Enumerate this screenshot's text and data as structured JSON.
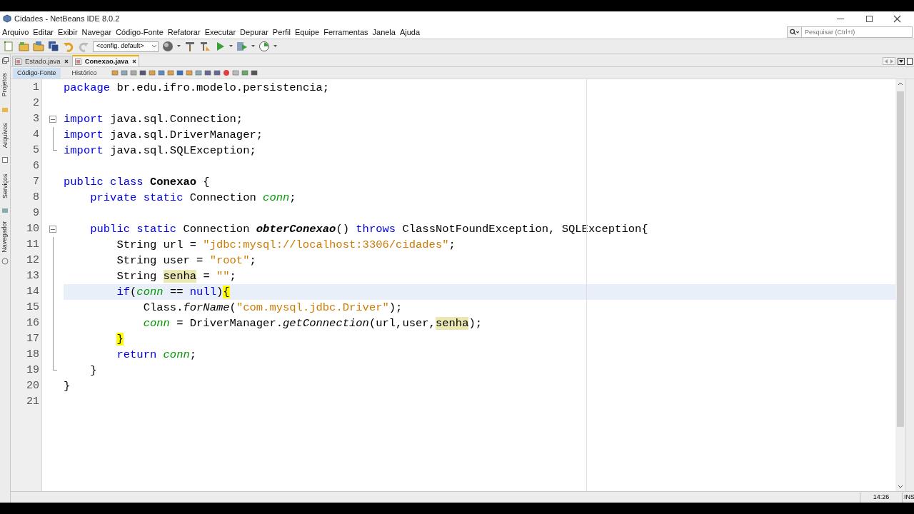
{
  "window": {
    "title": "Cidades - NetBeans IDE 8.0.2"
  },
  "menu": [
    "Arquivo",
    "Editar",
    "Exibir",
    "Navegar",
    "Código-Fonte",
    "Refatorar",
    "Executar",
    "Depurar",
    "Perfil",
    "Equipe",
    "Ferramentas",
    "Janela",
    "Ajuda"
  ],
  "search": {
    "placeholder": "Pesquisar (Ctrl+I)"
  },
  "toolbar": {
    "config": "<config. default>"
  },
  "side_panels": [
    {
      "label": "Projetos"
    },
    {
      "label": "Arquivos"
    },
    {
      "label": "Serviços"
    },
    {
      "label": "Navegador"
    }
  ],
  "tabs": [
    {
      "label": "Estado.java",
      "selected": false
    },
    {
      "label": "Conexao.java",
      "selected": true
    }
  ],
  "views": [
    {
      "label": "Código-Fonte",
      "selected": true
    },
    {
      "label": "Histórico",
      "selected": false
    }
  ],
  "code": [
    {
      "n": "1",
      "tokens": [
        {
          "text": "package",
          "kind": "keyword"
        },
        {
          "text": " br.edu.ifro.modelo.persistencia;",
          "kind": "plain"
        }
      ]
    },
    {
      "n": "2"
    },
    {
      "n": "3",
      "kind": "fold-start",
      "tokens": [
        {
          "text": "import",
          "kind": "keyword"
        },
        {
          "text": " java.sql.Connection;",
          "kind": "plain"
        }
      ]
    },
    {
      "n": "4",
      "kind": "fold-body",
      "tokens": [
        {
          "text": "import",
          "kind": "keyword"
        },
        {
          "text": " java.sql.DriverManager;",
          "kind": "plain"
        }
      ]
    },
    {
      "n": "5",
      "kind": "fold-end",
      "tokens": [
        {
          "text": "import",
          "kind": "keyword"
        },
        {
          "text": " java.sql.SQLException;",
          "kind": "plain"
        }
      ]
    },
    {
      "n": "6"
    },
    {
      "n": "7",
      "tokens": [
        {
          "text": "public class ",
          "kind": "keyword"
        },
        {
          "text": "Conexao",
          "kind": "class"
        },
        {
          "text": " {",
          "kind": "plain"
        }
      ]
    },
    {
      "n": "8",
      "tokens": [
        {
          "text": "    private static ",
          "kind": "keyword"
        },
        {
          "text": "Connection ",
          "kind": "plain"
        },
        {
          "text": "conn",
          "kind": "field"
        },
        {
          "text": ";",
          "kind": "plain"
        }
      ]
    },
    {
      "n": "9"
    },
    {
      "n": "10",
      "kind": "fold-start",
      "tokens": [
        {
          "text": "    public static ",
          "kind": "keyword"
        },
        {
          "text": "Connection ",
          "kind": "plain"
        },
        {
          "text": "obterConexao",
          "kind": "method-decl"
        },
        {
          "text": "() ",
          "kind": "plain"
        },
        {
          "text": "throws",
          "kind": "keyword"
        },
        {
          "text": " ClassNotFoundException, SQLException{",
          "kind": "plain"
        }
      ]
    },
    {
      "n": "11",
      "kind": "fold-body",
      "tokens": [
        {
          "text": "        String url = ",
          "kind": "plain"
        },
        {
          "text": "\"jdbc:mysql://localhost:3306/cidades\"",
          "kind": "string"
        },
        {
          "text": ";",
          "kind": "plain"
        }
      ]
    },
    {
      "n": "12",
      "kind": "fold-body",
      "tokens": [
        {
          "text": "        String user = ",
          "kind": "plain"
        },
        {
          "text": "\"root\"",
          "kind": "string"
        },
        {
          "text": ";",
          "kind": "plain"
        }
      ]
    },
    {
      "n": "13",
      "kind": "fold-body",
      "tokens": [
        {
          "text": "        String ",
          "kind": "plain"
        },
        {
          "text": "senha",
          "kind": "plain",
          "occurrence": true
        },
        {
          "text": " = ",
          "kind": "plain"
        },
        {
          "text": "\"\"",
          "kind": "string"
        },
        {
          "text": ";",
          "kind": "plain"
        }
      ]
    },
    {
      "n": "14",
      "kind": "fold-body",
      "current": true,
      "tokens": [
        {
          "text": "        if",
          "kind": "keyword"
        },
        {
          "text": "(",
          "kind": "plain"
        },
        {
          "text": "conn",
          "kind": "field"
        },
        {
          "text": " == ",
          "kind": "plain"
        },
        {
          "text": "null",
          "kind": "keyword"
        },
        {
          "text": ")",
          "kind": "plain"
        },
        {
          "text": "{",
          "kind": "plain",
          "brace_match": true
        }
      ]
    },
    {
      "n": "15",
      "kind": "fold-body",
      "tokens": [
        {
          "text": "            Class.",
          "kind": "plain"
        },
        {
          "text": "forName",
          "kind": "method"
        },
        {
          "text": "(",
          "kind": "plain"
        },
        {
          "text": "\"com.mysql.jdbc.Driver\"",
          "kind": "string"
        },
        {
          "text": ");",
          "kind": "plain"
        }
      ]
    },
    {
      "n": "16",
      "kind": "fold-body",
      "tokens": [
        {
          "text": "            conn",
          "kind": "field"
        },
        {
          "text": " = DriverManager.",
          "kind": "plain"
        },
        {
          "text": "getConnection",
          "kind": "method"
        },
        {
          "text": "(url,user,",
          "kind": "plain"
        },
        {
          "text": "senha",
          "kind": "plain",
          "occurrence": true
        },
        {
          "text": ");",
          "kind": "plain"
        }
      ]
    },
    {
      "n": "17",
      "kind": "fold-body",
      "tokens": [
        {
          "text": "        }",
          "kind": "plain",
          "brace_match": true
        }
      ]
    },
    {
      "n": "18",
      "kind": "fold-body",
      "tokens": [
        {
          "text": "        return ",
          "kind": "keyword"
        },
        {
          "text": "conn",
          "kind": "field"
        },
        {
          "text": ";",
          "kind": "plain"
        }
      ]
    },
    {
      "n": "19",
      "kind": "fold-end",
      "tokens": [
        {
          "text": "    }",
          "kind": "plain"
        }
      ]
    },
    {
      "n": "20",
      "tokens": [
        {
          "text": "}",
          "kind": "plain"
        }
      ]
    },
    {
      "n": "21"
    }
  ],
  "status_bar": {
    "position": "14:26",
    "mode": "INS"
  }
}
